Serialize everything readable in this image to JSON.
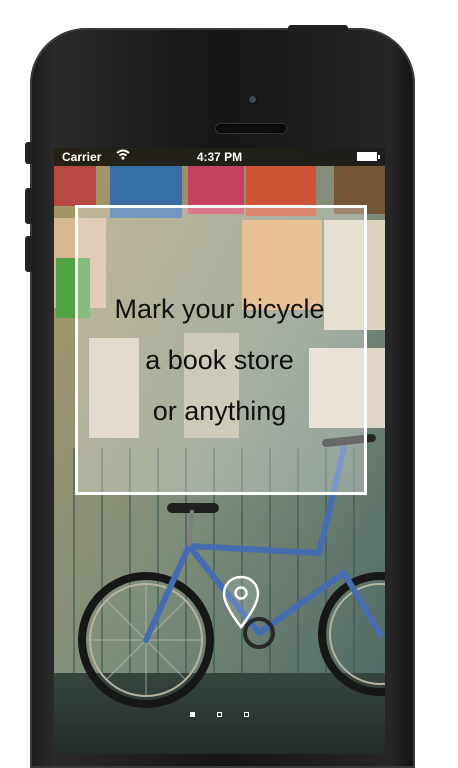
{
  "status_bar": {
    "carrier": "Carrier",
    "wifi_icon": "wifi-icon",
    "time": "4:37 PM",
    "battery_icon": "battery-icon"
  },
  "onboarding": {
    "lines": [
      "Mark your bicycle",
      "a book store",
      "or anything"
    ],
    "location_icon": "map-pin-icon",
    "pages": {
      "count": 3,
      "current": 1
    }
  },
  "colors": {
    "text": "#111111",
    "frame": "#ffffff",
    "status_bar": "#000000"
  }
}
